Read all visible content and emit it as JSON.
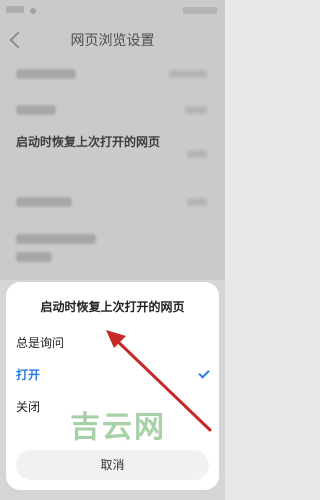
{
  "header": {
    "title": "网页浏览设置"
  },
  "settings": {
    "restore_row_label": "启动时恢复上次打开的网页"
  },
  "sheet": {
    "title": "启动时恢复上次打开的网页",
    "options": [
      {
        "label": "总是询问",
        "selected": false
      },
      {
        "label": "打开",
        "selected": true
      },
      {
        "label": "关闭",
        "selected": false
      }
    ],
    "cancel_label": "取消"
  },
  "watermark": {
    "text": "吉云网"
  },
  "colors": {
    "accent": "#2a7ae2",
    "annotation_arrow": "#c62828"
  },
  "icons": {
    "back": "back-arrow-icon",
    "selected": "check-icon"
  }
}
